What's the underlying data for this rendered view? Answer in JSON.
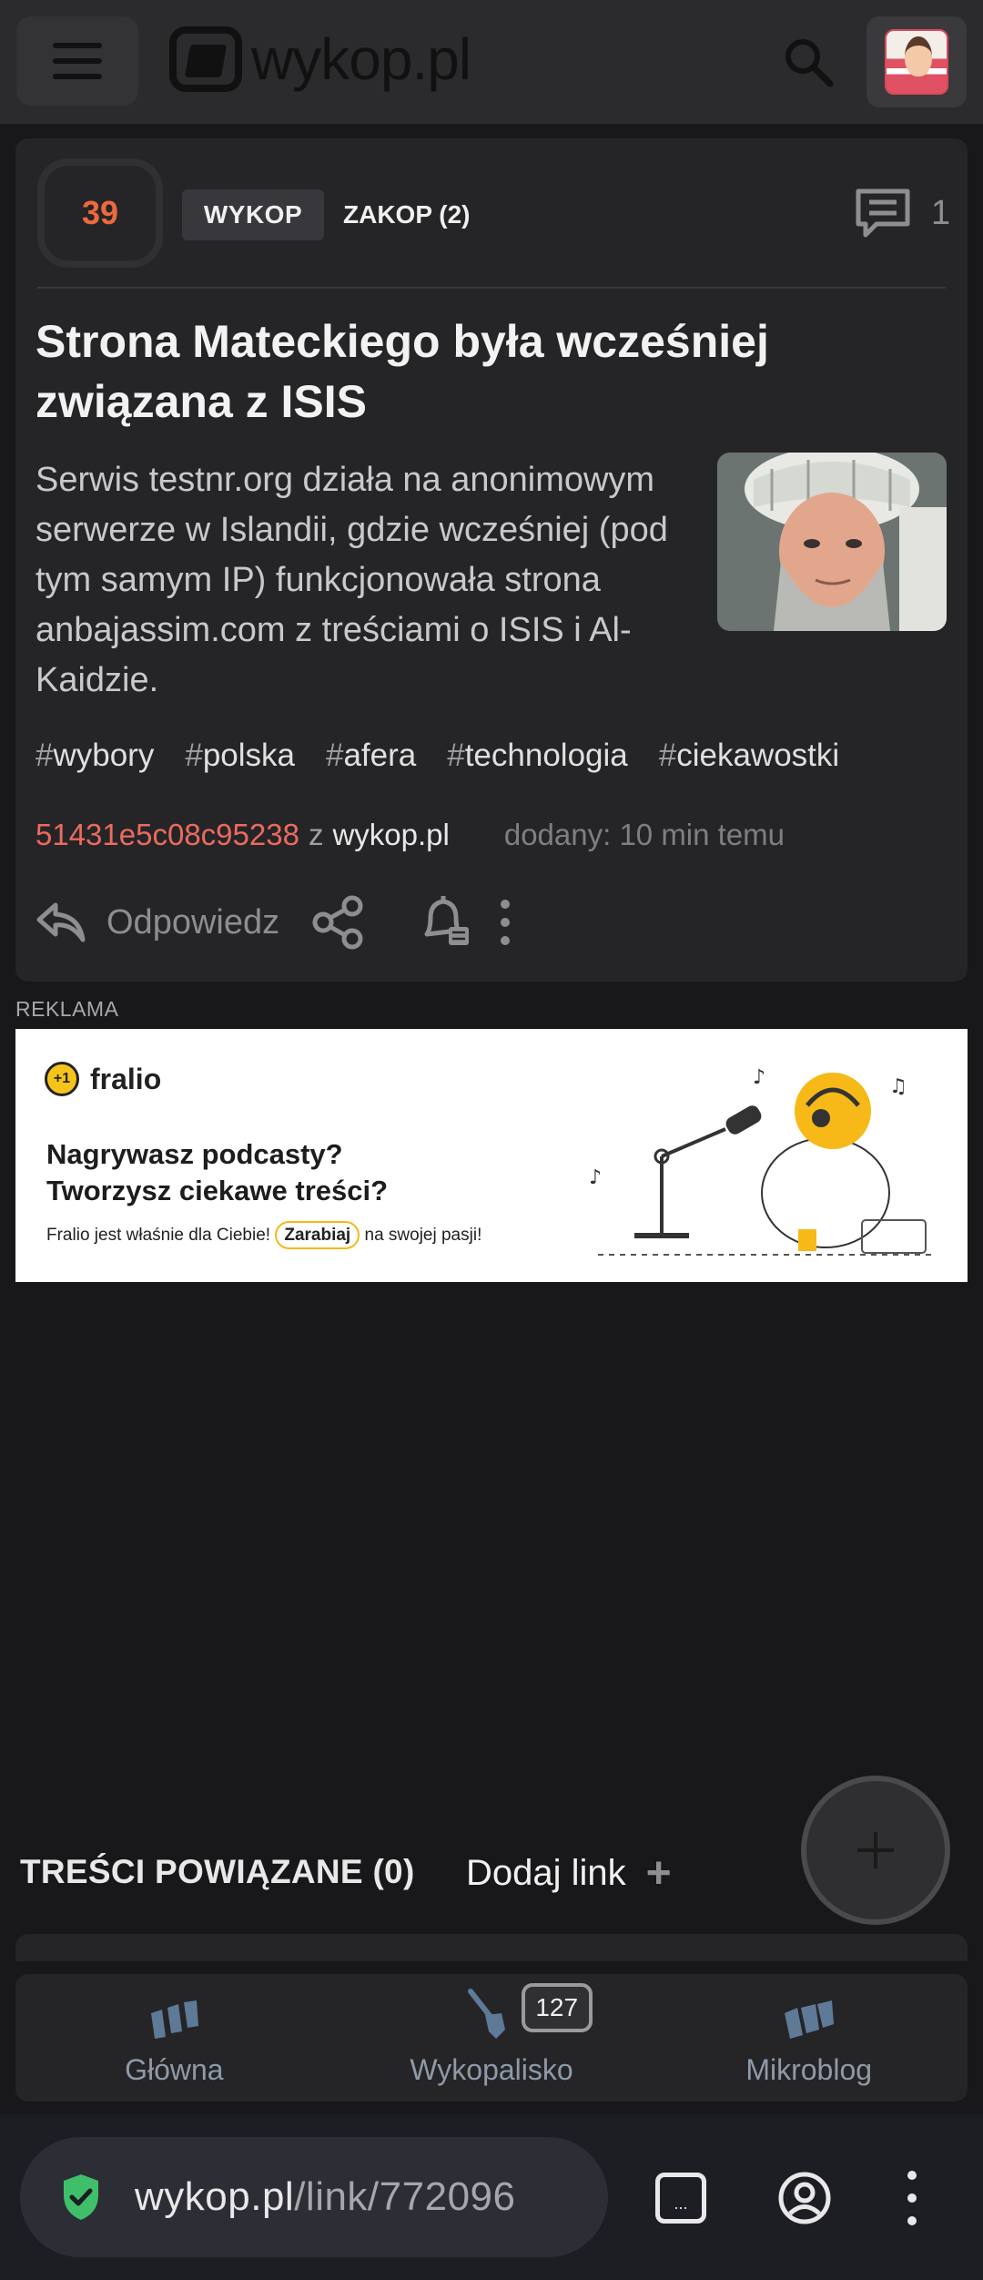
{
  "app": {
    "logo_text": "wykop.pl"
  },
  "post": {
    "votes": "39",
    "wykop_label": "WYKOP",
    "zakop_label": "ZAKOP (2)",
    "comments_count": "1",
    "title": "Strona Mateckiego była wcześniej związana z ISIS",
    "description": "Serwis testnr.org działa na anonimowym serwerze w Islandii, gdzie wcześniej (pod tym samym IP) funkcjonowała strona anbajassim.com z treściami o ISIS i Al-Kaidzie.",
    "tags": [
      {
        "hash": "#",
        "name": "wybory"
      },
      {
        "hash": "#",
        "name": "polska"
      },
      {
        "hash": "#",
        "name": "afera"
      },
      {
        "hash": "#",
        "name": "technologia"
      },
      {
        "hash": "#",
        "name": "ciekawostki"
      }
    ],
    "author": "51431e5c08c95238",
    "from_word": "z",
    "domain": "wykop.pl",
    "added": "dodany: 10 min temu",
    "reply_label": "Odpowiedz"
  },
  "ad": {
    "label": "REKLAMA",
    "brand_mark": "+1",
    "brand": "fralio",
    "headline_1": "Nagrywasz podcasty?",
    "headline_2": "Tworzysz ciekawe treści?",
    "sub_before": "Fralio jest właśnie dla Ciebie!",
    "sub_highlight": "Zarabiaj",
    "sub_after": "na swojej pasji!"
  },
  "related": {
    "title": "TREŚCI POWIĄZANE (0)",
    "add_link": "Dodaj link",
    "add_plus": "+",
    "fab_plus": "+"
  },
  "bottom_nav": {
    "items": [
      {
        "label": "Główna",
        "icon": "home-icon"
      },
      {
        "label": "Wykopalisko",
        "icon": "shovel-icon",
        "badge": "127"
      },
      {
        "label": "Mikroblog",
        "icon": "mikroblog-icon"
      }
    ]
  },
  "browser": {
    "url_main": "wykop.pl",
    "url_rest": "/link/772096",
    "tabs_label": "..."
  },
  "colors": {
    "accent_orange": "#ec6a3d",
    "author_red": "#ec6a5e",
    "background": "#18181b",
    "card": "#252528"
  }
}
